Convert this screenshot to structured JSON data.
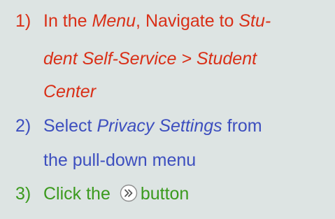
{
  "steps": [
    {
      "number": "1)",
      "color": "#d92f17",
      "text_a": "In the ",
      "menu": "Menu",
      "text_b": ", Navigate to ",
      "path_line1": "Stu-",
      "path_line2": "dent Self-Service > Student",
      "path_line3": "Center"
    },
    {
      "number": "2)",
      "color": "#3d4fbf",
      "text_a": "Select ",
      "option": "Privacy Settings",
      "text_b": " from",
      "line2": "the pull-down menu"
    },
    {
      "number": "3)",
      "color": "#3b9a1e",
      "text_a": "Click the ",
      "icon": "double-chevron-right-icon",
      "text_b": "button"
    }
  ]
}
